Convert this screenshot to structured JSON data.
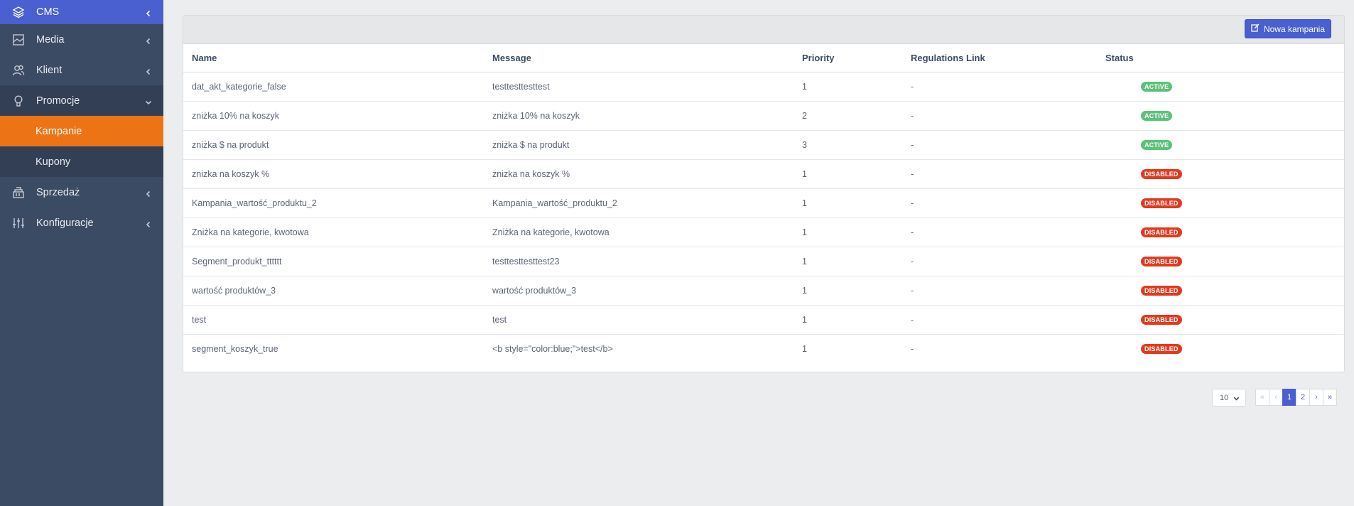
{
  "sidebar": {
    "cms": "CMS",
    "media": "Media",
    "klient": "Klient",
    "promocje": "Promocje",
    "kampanie": "Kampanie",
    "kupony": "Kupony",
    "sprzedaz": "Sprzedaż",
    "konfiguracje": "Konfiguracje"
  },
  "toolbar": {
    "new_campaign": "Nowa kampania"
  },
  "table": {
    "headers": {
      "name": "Name",
      "message": "Message",
      "priority": "Priority",
      "regulations": "Regulations Link",
      "status": "Status"
    },
    "rows": [
      {
        "name": "dat_akt_kategorie_false",
        "message": "testtesttesttest",
        "priority": "1",
        "regulations": "-",
        "status": "ACTIVE"
      },
      {
        "name": "zniżka 10% na koszyk",
        "message": "zniżka 10% na koszyk",
        "priority": "2",
        "regulations": "-",
        "status": "ACTIVE"
      },
      {
        "name": "zniżka $ na produkt",
        "message": "zniżka $ na produkt",
        "priority": "3",
        "regulations": "-",
        "status": "ACTIVE"
      },
      {
        "name": "znizka na koszyk %",
        "message": "znizka na koszyk %",
        "priority": "1",
        "regulations": "-",
        "status": "DISABLED"
      },
      {
        "name": "Kampania_wartość_produktu_2",
        "message": "Kampania_wartość_produktu_2",
        "priority": "1",
        "regulations": "-",
        "status": "DISABLED"
      },
      {
        "name": "Zniżka na kategorie, kwotowa",
        "message": "Zniżka na kategorie, kwotowa",
        "priority": "1",
        "regulations": "-",
        "status": "DISABLED"
      },
      {
        "name": "Segment_produkt_tttttt",
        "message": "testtesttesttest23",
        "priority": "1",
        "regulations": "-",
        "status": "DISABLED"
      },
      {
        "name": "wartość produktów_3",
        "message": "wartość produktów_3",
        "priority": "1",
        "regulations": "-",
        "status": "DISABLED"
      },
      {
        "name": "test",
        "message": "test",
        "priority": "1",
        "regulations": "-",
        "status": "DISABLED"
      },
      {
        "name": "segment_koszyk_true",
        "message": "<b style=\"color:blue;\">test</b>",
        "priority": "1",
        "regulations": "-",
        "status": "DISABLED"
      }
    ]
  },
  "pagination": {
    "page_size": "10",
    "first": "«",
    "prev": "‹",
    "pages": [
      "1",
      "2"
    ],
    "next": "›",
    "last": "»"
  },
  "colors": {
    "accent": "#4a5fd0",
    "sidebar": "#3c4b64",
    "active_item": "#ed7414",
    "status_active": "#5bc27a",
    "status_disabled": "#e23a1f"
  }
}
